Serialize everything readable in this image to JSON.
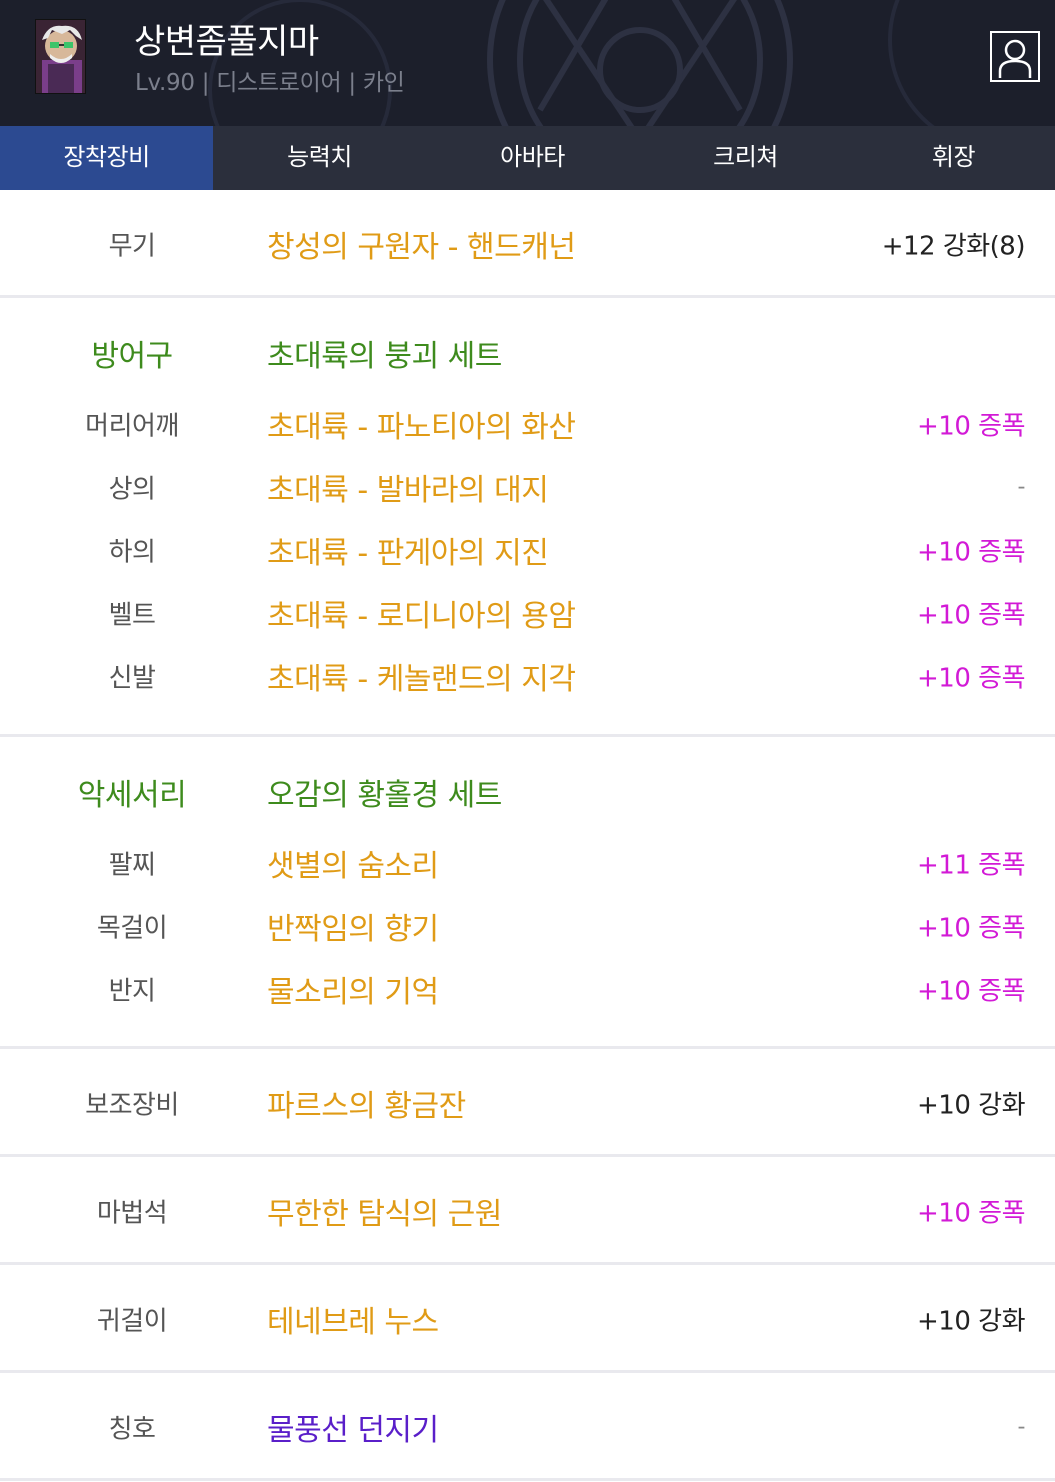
{
  "header": {
    "character_name": "상변좀풀지마",
    "character_info": "Lv.90 | 디스트로이어 | 카인",
    "profile_icon": "user-profile-icon"
  },
  "tabs": [
    {
      "label": "장착장비",
      "active": true
    },
    {
      "label": "능력치",
      "active": false
    },
    {
      "label": "아바타",
      "active": false
    },
    {
      "label": "크리쳐",
      "active": false
    },
    {
      "label": "휘장",
      "active": false
    }
  ],
  "weapon": {
    "label": "무기",
    "item": "창성의 구원자 - 핸드캐넌",
    "upgrade": "+12 강화(8)"
  },
  "armor": {
    "label": "방어구",
    "set_name": "초대륙의 붕괴 세트",
    "items": [
      {
        "label": "머리어깨",
        "item": "초대륙 - 파노티아의 화산",
        "upgrade": "+10 증폭"
      },
      {
        "label": "상의",
        "item": "초대륙 - 발바라의 대지",
        "upgrade": "-"
      },
      {
        "label": "하의",
        "item": "초대륙 - 판게아의 지진",
        "upgrade": "+10 증폭"
      },
      {
        "label": "벨트",
        "item": "초대륙 - 로디니아의 용암",
        "upgrade": "+10 증폭"
      },
      {
        "label": "신발",
        "item": "초대륙 - 케놀랜드의 지각",
        "upgrade": "+10 증폭"
      }
    ]
  },
  "accessory": {
    "label": "악세서리",
    "set_name": "오감의 황홀경 세트",
    "items": [
      {
        "label": "팔찌",
        "item": "샛별의 숨소리",
        "upgrade": "+11 증폭"
      },
      {
        "label": "목걸이",
        "item": "반짝임의 향기",
        "upgrade": "+10 증폭"
      },
      {
        "label": "반지",
        "item": "물소리의 기억",
        "upgrade": "+10 증폭"
      }
    ]
  },
  "subweapon": {
    "label": "보조장비",
    "item": "파르스의 황금잔",
    "upgrade": "+10 강화"
  },
  "magicstone": {
    "label": "마법석",
    "item": "무한한 탐식의 근원",
    "upgrade": "+10 증폭"
  },
  "earring": {
    "label": "귀걸이",
    "item": "테네브레 누스",
    "upgrade": "+10 강화"
  },
  "title": {
    "label": "칭호",
    "item": "물풍선 던지기",
    "upgrade": "-"
  },
  "colors": {
    "header_bg": "#1c1f2b",
    "tab_bar": "#2b2f3c",
    "tab_active": "#2c4a91",
    "item_gold": "#e09b16",
    "set_green": "#3e8b1d",
    "amplify_magenta": "#d21ad6",
    "title_purple": "#5a1fc9"
  }
}
